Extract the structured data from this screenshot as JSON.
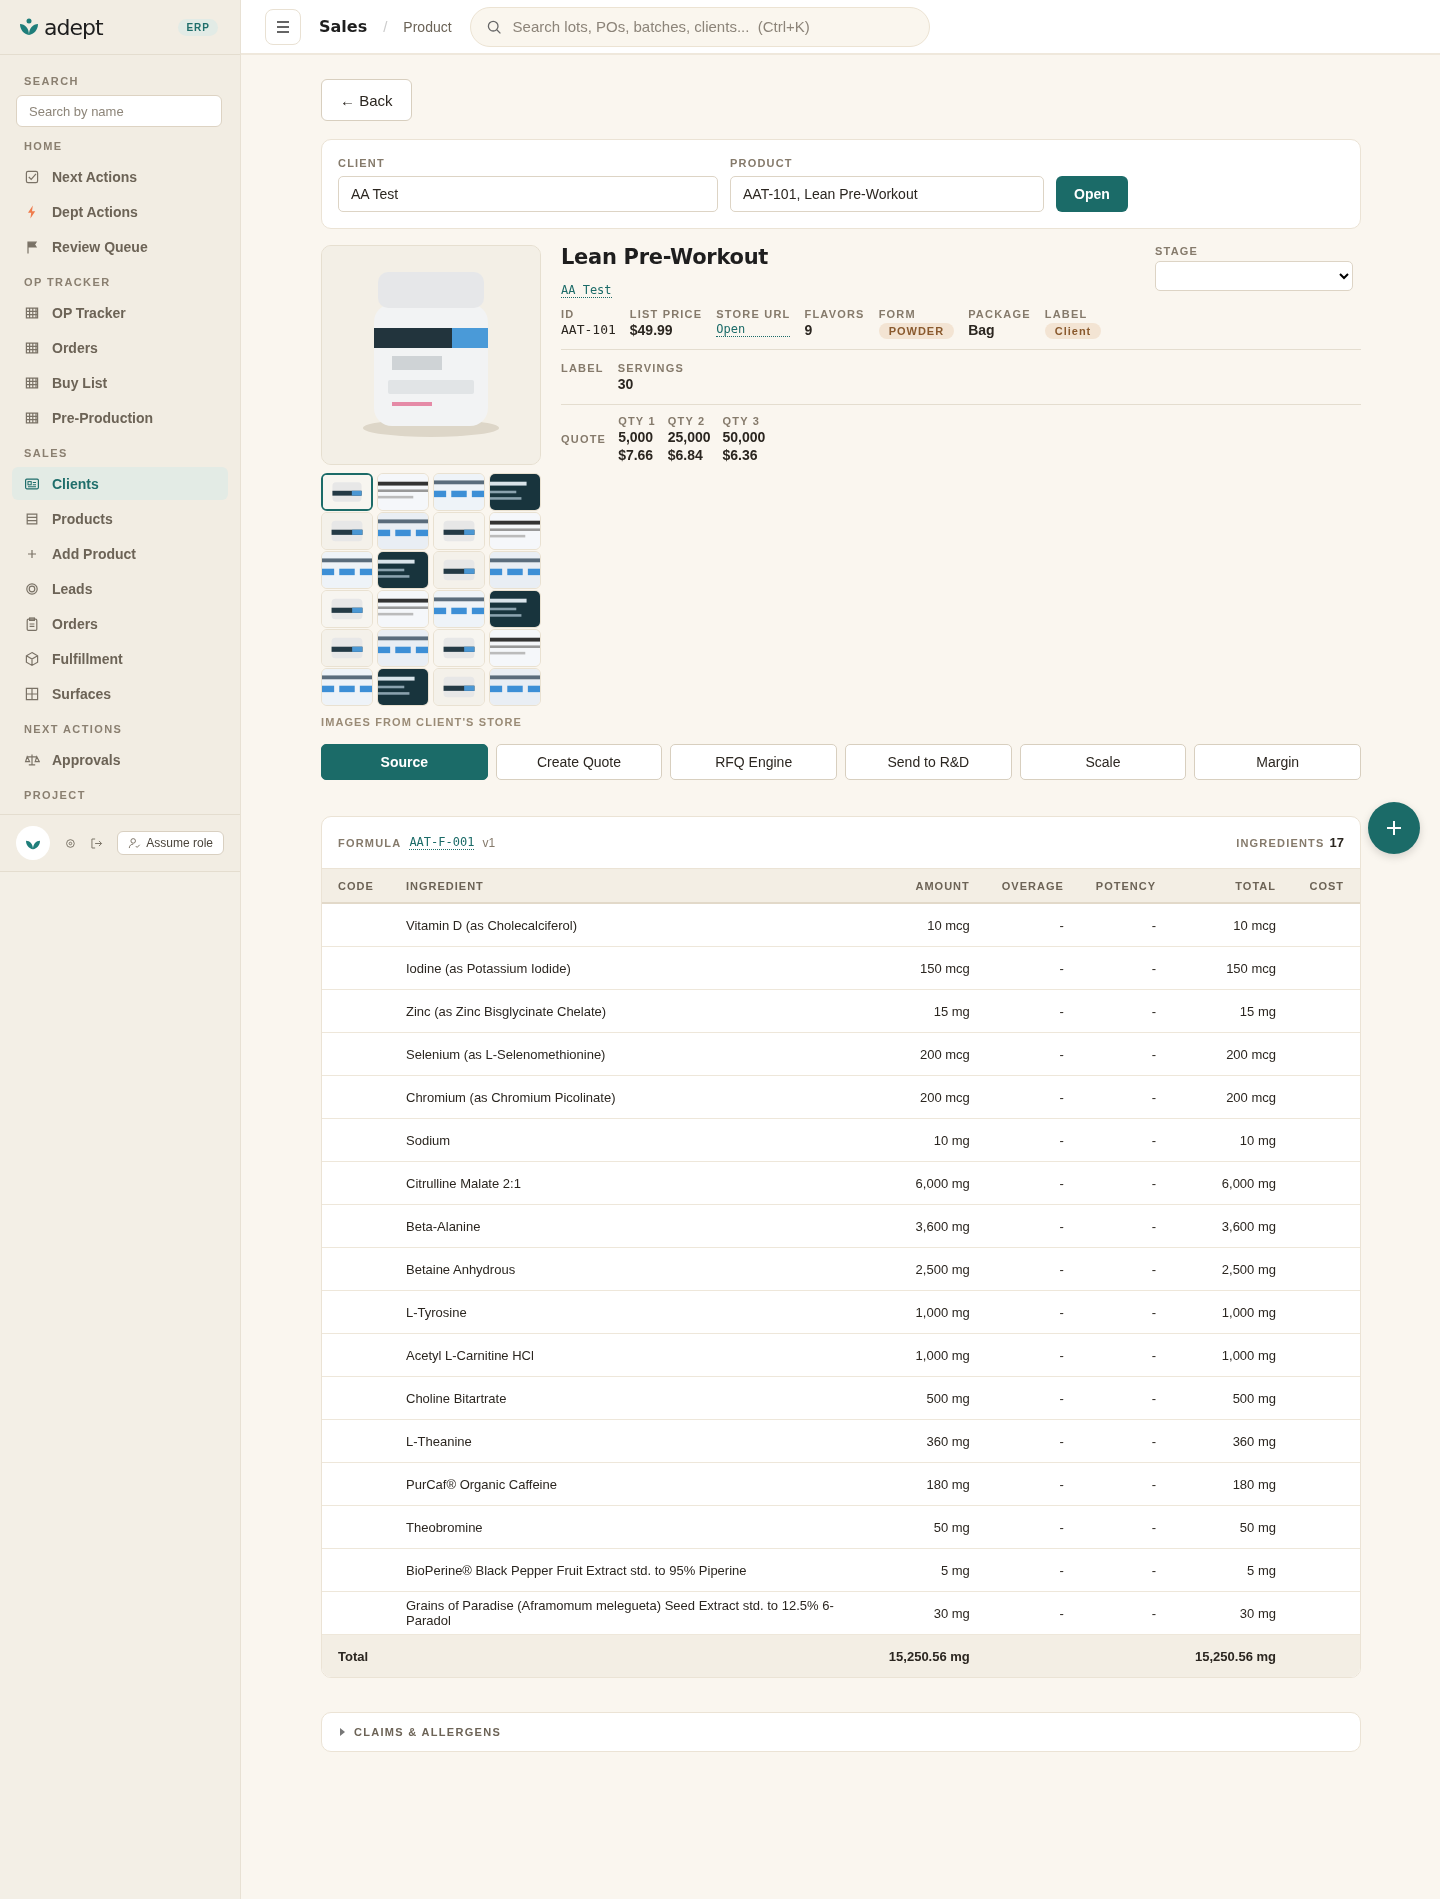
{
  "sidebar": {
    "logo": {
      "name": "adept",
      "badge": "ERP"
    },
    "search": {
      "title": "SEARCH",
      "placeholder": "Search by name"
    },
    "sections": [
      {
        "title": "HOME",
        "items": [
          {
            "label": "Next Actions",
            "selected": false
          },
          {
            "label": "Dept Actions",
            "selected": false
          },
          {
            "label": "Review Queue",
            "selected": false
          }
        ]
      },
      {
        "title": "OP TRACKER",
        "items": [
          {
            "label": "OP Tracker",
            "selected": false
          },
          {
            "label": "Orders",
            "selected": false
          },
          {
            "label": "Buy List",
            "selected": false
          },
          {
            "label": "Pre-Production",
            "selected": false
          }
        ]
      },
      {
        "title": "SALES",
        "items": [
          {
            "label": "Clients",
            "selected": true
          },
          {
            "label": "Products",
            "selected": false
          },
          {
            "label": "Add Product",
            "selected": false
          },
          {
            "label": "Leads",
            "selected": false
          },
          {
            "label": "Orders",
            "selected": false
          },
          {
            "label": "Fulfillment",
            "selected": false
          },
          {
            "label": "Surfaces",
            "selected": false
          }
        ]
      },
      {
        "title": "NEXT ACTIONS",
        "items": [
          {
            "label": "Approvals",
            "selected": false
          }
        ]
      },
      {
        "title": "PROJECT"
      }
    ],
    "footer": {
      "button": "Assume role"
    }
  },
  "header": {
    "breadcrumb": [
      "Sales",
      "Product"
    ],
    "separator": "/",
    "search": {
      "placeholder": "Search lots, POs, batches, clients...  (Ctrl+K)"
    }
  },
  "back_button": "← Back",
  "picker": {
    "client": {
      "label": "CLIENT",
      "value": "AA Test"
    },
    "product": {
      "label": "PRODUCT",
      "value": "AAT-101, Lean Pre-Workout"
    },
    "button": "Open"
  },
  "product": {
    "title": "Lean Pre-Workout",
    "client_link": "AA Test",
    "stage": {
      "label": "STAGE"
    },
    "fields": [
      {
        "label": "ID",
        "value": "AAT-101",
        "kind": "mono"
      },
      {
        "label": "LIST PRICE",
        "value": "$49.99",
        "kind": "text"
      },
      {
        "label": "STORE URL",
        "value": "Open",
        "kind": "link"
      },
      {
        "label": "FLAVORS",
        "value": "9",
        "kind": "text"
      },
      {
        "label": "FORM",
        "value": "POWDER",
        "kind": "tag"
      },
      {
        "label": "PACKAGE",
        "value": "Bag",
        "kind": "text"
      },
      {
        "label": "LABEL",
        "value": "Client",
        "kind": "tag"
      }
    ],
    "label_row": {
      "title": "LABEL",
      "fields": [
        {
          "label": "SERVINGS",
          "value": "30"
        }
      ]
    },
    "quote": {
      "title": "QUOTE",
      "tiers": [
        {
          "label": "QTY 1",
          "qty": "5,000",
          "price": "$7.66"
        },
        {
          "label": "QTY 2",
          "qty": "25,000",
          "price": "$6.84"
        },
        {
          "label": "QTY 3",
          "qty": "50,000",
          "price": "$6.36"
        }
      ]
    },
    "thumbnails": [
      {
        "selected": true
      },
      {
        "selected": false
      },
      {
        "selected": false
      },
      {
        "selected": false
      },
      {
        "selected": false
      },
      {
        "selected": false
      },
      {
        "selected": false
      },
      {
        "selected": false
      },
      {
        "selected": false
      },
      {
        "selected": false
      },
      {
        "selected": false
      },
      {
        "selected": false
      },
      {
        "selected": false
      },
      {
        "selected": false
      },
      {
        "selected": false
      },
      {
        "selected": false
      },
      {
        "selected": false
      },
      {
        "selected": false
      },
      {
        "selected": false
      },
      {
        "selected": false
      },
      {
        "selected": false
      },
      {
        "selected": false
      },
      {
        "selected": false
      },
      {
        "selected": false
      }
    ],
    "images_caption": "IMAGES FROM CLIENT'S STORE"
  },
  "actions": [
    {
      "label": "Source",
      "selected": true
    },
    {
      "label": "Create Quote",
      "selected": false
    },
    {
      "label": "RFQ Engine",
      "selected": false
    },
    {
      "label": "Send to R&D",
      "selected": false
    },
    {
      "label": "Scale",
      "selected": false
    },
    {
      "label": "Margin",
      "selected": false
    }
  ],
  "formula": {
    "label": "FORMULA",
    "code": "AAT-F-001",
    "version": "v1",
    "count_label": "INGREDIENTS",
    "count": "17",
    "columns": [
      "CODE",
      "INGREDIENT",
      "AMOUNT",
      "OVERAGE",
      "POTENCY",
      "TOTAL",
      "COST"
    ],
    "rows": [
      {
        "ingredient": "Vitamin D (as Cholecalciferol)",
        "amount": "10 mcg",
        "overage": "-",
        "potency": "-",
        "total": "10 mcg"
      },
      {
        "ingredient": "Iodine (as Potassium Iodide)",
        "amount": "150 mcg",
        "overage": "-",
        "potency": "-",
        "total": "150 mcg"
      },
      {
        "ingredient": "Zinc (as Zinc Bisglycinate Chelate)",
        "amount": "15 mg",
        "overage": "-",
        "potency": "-",
        "total": "15 mg"
      },
      {
        "ingredient": "Selenium (as L-Selenomethionine)",
        "amount": "200 mcg",
        "overage": "-",
        "potency": "-",
        "total": "200 mcg"
      },
      {
        "ingredient": "Chromium (as Chromium Picolinate)",
        "amount": "200 mcg",
        "overage": "-",
        "potency": "-",
        "total": "200 mcg"
      },
      {
        "ingredient": "Sodium",
        "amount": "10 mg",
        "overage": "-",
        "potency": "-",
        "total": "10 mg"
      },
      {
        "ingredient": "Citrulline Malate 2:1",
        "amount": "6,000 mg",
        "overage": "-",
        "potency": "-",
        "total": "6,000 mg"
      },
      {
        "ingredient": "Beta-Alanine",
        "amount": "3,600 mg",
        "overage": "-",
        "potency": "-",
        "total": "3,600 mg"
      },
      {
        "ingredient": "Betaine Anhydrous",
        "amount": "2,500 mg",
        "overage": "-",
        "potency": "-",
        "total": "2,500 mg"
      },
      {
        "ingredient": "L-Tyrosine",
        "amount": "1,000 mg",
        "overage": "-",
        "potency": "-",
        "total": "1,000 mg"
      },
      {
        "ingredient": "Acetyl L-Carnitine HCl",
        "amount": "1,000 mg",
        "overage": "-",
        "potency": "-",
        "total": "1,000 mg"
      },
      {
        "ingredient": "Choline Bitartrate",
        "amount": "500 mg",
        "overage": "-",
        "potency": "-",
        "total": "500 mg"
      },
      {
        "ingredient": "L-Theanine",
        "amount": "360 mg",
        "overage": "-",
        "potency": "-",
        "total": "360 mg"
      },
      {
        "ingredient": "PurCaf® Organic Caffeine",
        "amount": "180 mg",
        "overage": "-",
        "potency": "-",
        "total": "180 mg"
      },
      {
        "ingredient": "Theobromine",
        "amount": "50 mg",
        "overage": "-",
        "potency": "-",
        "total": "50 mg"
      },
      {
        "ingredient": "BioPerine® Black Pepper Fruit Extract std. to 95% Piperine",
        "amount": "5 mg",
        "overage": "-",
        "potency": "-",
        "total": "5 mg"
      },
      {
        "ingredient": "Grains of Paradise (Aframomum melegueta) Seed Extract std. to 12.5% 6-Paradol",
        "amount": "30 mg",
        "overage": "-",
        "potency": "-",
        "total": "30 mg"
      }
    ],
    "total": {
      "label": "Total",
      "amount": "15,250.56 mg",
      "total": "15,250.56 mg"
    }
  },
  "claims": {
    "title": "CLAIMS & ALLERGENS",
    "expanded": false
  }
}
